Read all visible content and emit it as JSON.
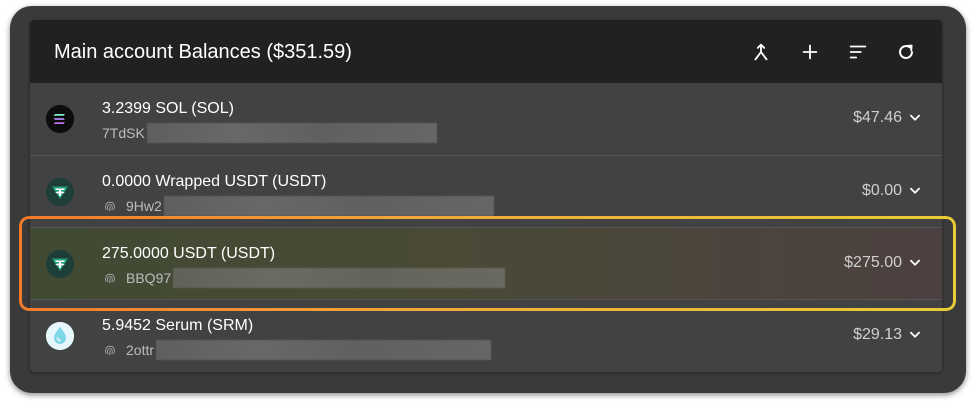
{
  "header": {
    "title": "Main account Balances ($351.59)",
    "buttons": [
      {
        "name": "merge-accounts",
        "icon": "merge-icon"
      },
      {
        "name": "add-token",
        "icon": "plus-icon"
      },
      {
        "name": "sort",
        "icon": "sort-icon"
      },
      {
        "name": "refresh",
        "icon": "refresh-icon"
      }
    ]
  },
  "rows": [
    {
      "primary": "3.2399 SOL (SOL)",
      "address_prefix": "7TdSK",
      "value": "$47.46",
      "icon": "solana-icon",
      "show_fingerprint": false
    },
    {
      "primary": "0.0000 Wrapped USDT (USDT)",
      "address_prefix": "9Hw2",
      "value": "$0.00",
      "icon": "tether-icon",
      "show_fingerprint": true
    },
    {
      "primary": "275.0000 USDT (USDT)",
      "address_prefix": "BBQ97",
      "value": "$275.00",
      "icon": "tether-icon",
      "show_fingerprint": true,
      "highlighted": true
    },
    {
      "primary": "5.9452 Serum (SRM)",
      "address_prefix": "2ottr",
      "value": "$29.13",
      "icon": "serum-icon",
      "show_fingerprint": true
    }
  ],
  "colors": {
    "background": "#3a3a3a",
    "panel": "#424242",
    "header": "#212121",
    "highlight_border_start": "#f27a2a",
    "highlight_border_end": "#e9cc35",
    "tether": "#26a17b",
    "serum": "#7fd7e8"
  }
}
